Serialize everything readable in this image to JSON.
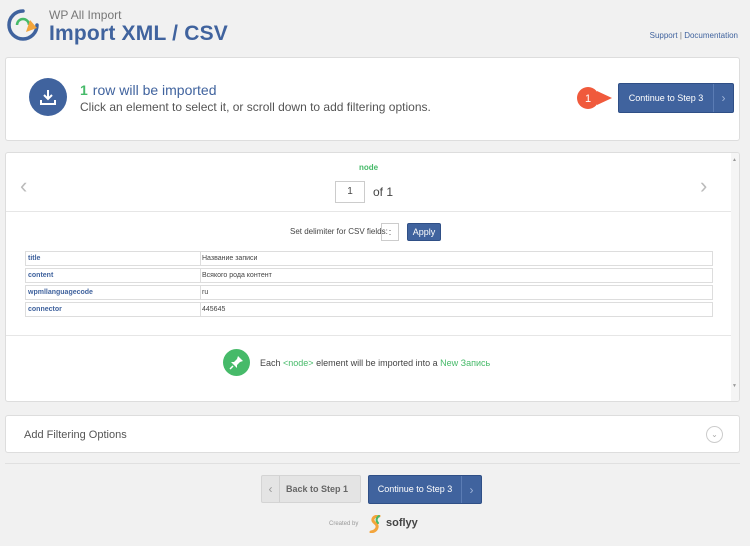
{
  "header": {
    "brand": "WP All Import",
    "title": "Import XML / CSV",
    "support_link": "Support",
    "link_separator": "|",
    "documentation_link": "Documentation"
  },
  "summary": {
    "row_count": "1",
    "rows_text": "row will be imported",
    "instruction": "Click an element to select it, or scroll down to add filtering options.",
    "badge_number": "1",
    "continue_label": "Continue to Step 3",
    "colors": {
      "accent": "#40639e",
      "green": "#46ba69",
      "badge": "#f05a3c"
    }
  },
  "preview": {
    "node_label": "node",
    "page_value": "1",
    "page_of": "of 1",
    "delimiter_label": "Set delimiter for CSV fields:",
    "delimiter_value": ":",
    "apply_label": "Apply",
    "rows": [
      {
        "key": "title",
        "value": "Название записи"
      },
      {
        "key": "content",
        "value": "Всякого рода контент"
      },
      {
        "key": "wpmllanguagecode",
        "value": "ru"
      },
      {
        "key": "connector",
        "value": "445645"
      }
    ],
    "each_prefix": "Each",
    "each_node": "<node>",
    "each_middle": "element will be imported into a",
    "each_target": "New Запись"
  },
  "filtering": {
    "label": "Add Filtering Options"
  },
  "footer": {
    "back_label": "Back to Step 1",
    "continue_label": "Continue to Step 3",
    "created_by": "Created by",
    "company": "soflyy"
  }
}
